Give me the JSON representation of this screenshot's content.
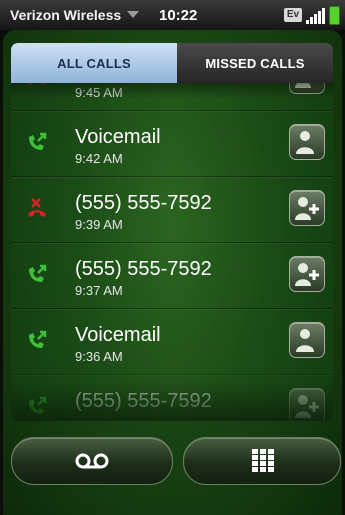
{
  "status_bar": {
    "carrier": "Verizon Wireless",
    "time": "10:22",
    "network_badge": "Ev"
  },
  "tabs": [
    {
      "label": "ALL CALLS",
      "active": true
    },
    {
      "label": "MISSED CALLS",
      "active": false
    }
  ],
  "calls": [
    {
      "name": "",
      "time": "9:45 AM",
      "type": "missed",
      "contact_action": "add-contact-icon"
    },
    {
      "name": "Voicemail",
      "time": "9:42 AM",
      "type": "outgoing",
      "contact_action": "contact-icon"
    },
    {
      "name": "(555) 555-7592",
      "time": "9:39 AM",
      "type": "missed",
      "contact_action": "add-contact-icon"
    },
    {
      "name": "(555) 555-7592",
      "time": "9:37 AM",
      "type": "outgoing",
      "contact_action": "add-contact-icon"
    },
    {
      "name": "Voicemail",
      "time": "9:36 AM",
      "type": "outgoing",
      "contact_action": "contact-icon"
    },
    {
      "name": "(555) 555-7592",
      "time": "",
      "type": "outgoing",
      "contact_action": "add-contact-icon"
    }
  ],
  "bottom_buttons": [
    {
      "icon": "voicemail-icon"
    },
    {
      "icon": "dialpad-icon"
    }
  ],
  "colors": {
    "outgoing": "#3fbf3a",
    "missed": "#d8232a",
    "tab_active": "#a9c6e6"
  }
}
